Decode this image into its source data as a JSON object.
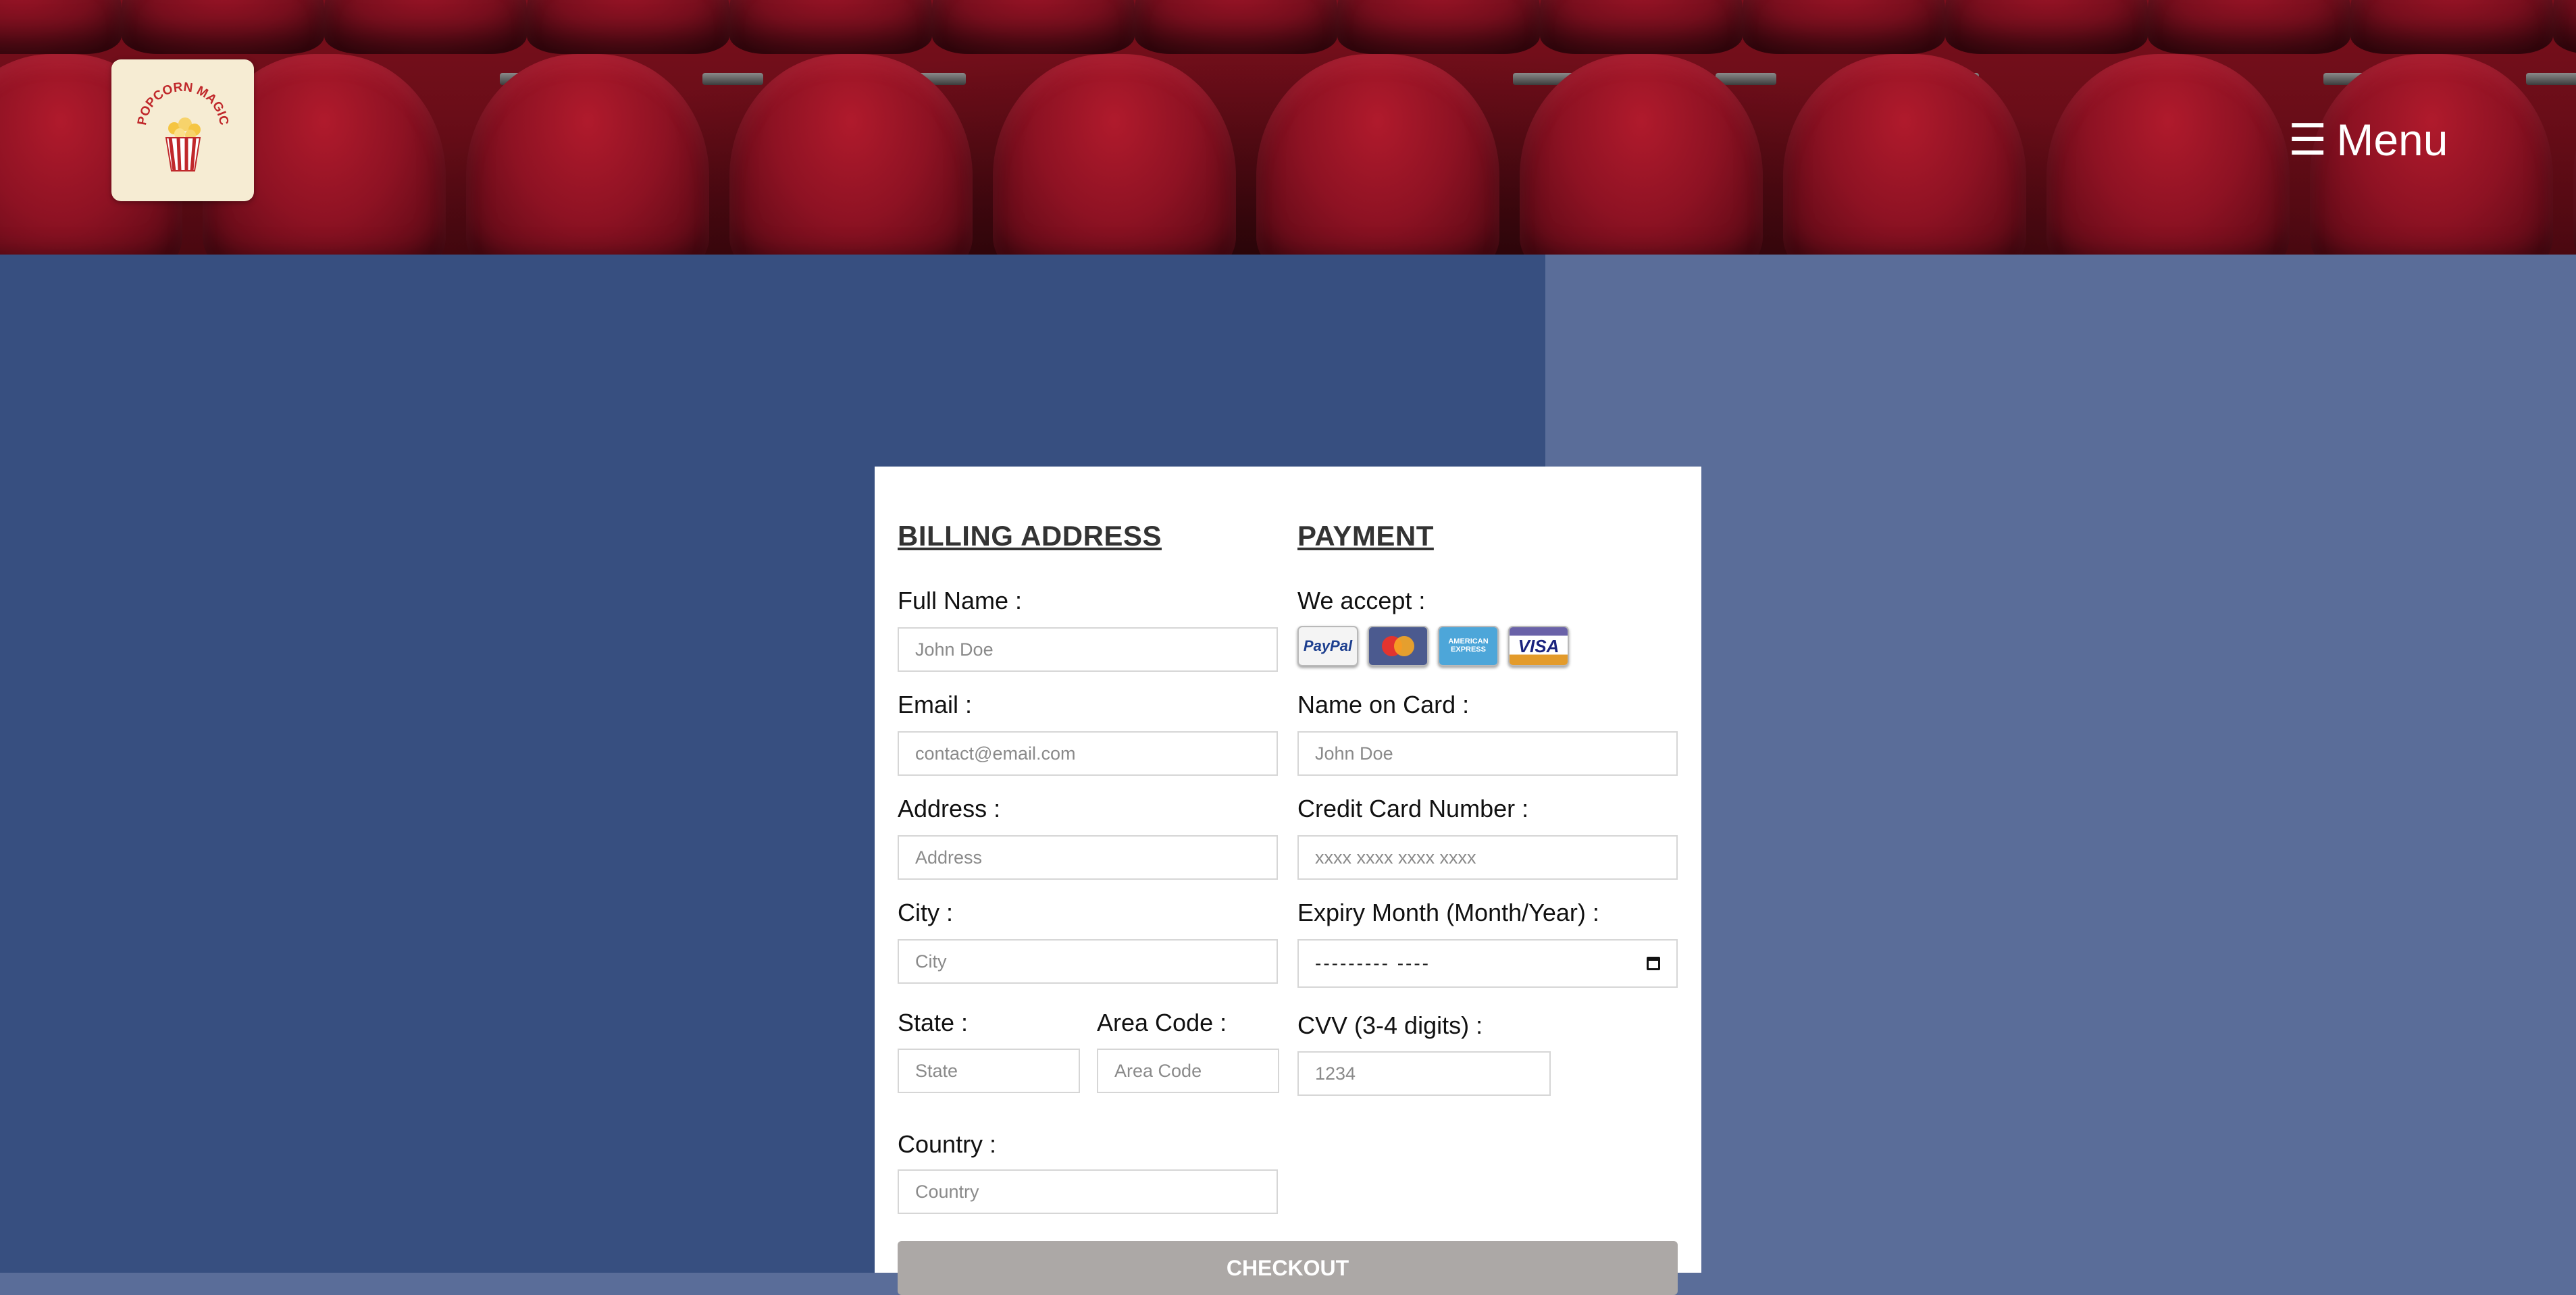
{
  "header": {
    "logo_name": "popcorn-logo",
    "logo_text": "POPCORN MAGIC",
    "menu_label": "Menu",
    "menu_icon": "hamburger-icon"
  },
  "billing": {
    "title": "BILLING ADDRESS",
    "full_name": {
      "label": "Full Name :",
      "placeholder": "John Doe"
    },
    "email": {
      "label": "Email :",
      "placeholder": "contact@email.com"
    },
    "address": {
      "label": "Address :",
      "placeholder": "Address"
    },
    "city": {
      "label": "City :",
      "placeholder": "City"
    },
    "state": {
      "label": "State :",
      "placeholder": "State"
    },
    "area_code": {
      "label": "Area Code :",
      "placeholder": "Area Code"
    },
    "country": {
      "label": "Country :",
      "placeholder": "Country"
    }
  },
  "payment": {
    "title": "PAYMENT",
    "we_accept_label": "We accept :",
    "cards": [
      {
        "name": "paypal-icon",
        "text": "PayPal"
      },
      {
        "name": "mastercard-icon",
        "text": "MasterCard"
      },
      {
        "name": "amex-icon",
        "text": "AMERICAN EXPRESS"
      },
      {
        "name": "visa-icon",
        "text": "VISA"
      }
    ],
    "name_on_card": {
      "label": "Name on Card :",
      "placeholder": "John Doe"
    },
    "card_number": {
      "label": "Credit Card Number :",
      "placeholder": "xxxx xxxx xxxx xxxx"
    },
    "expiry": {
      "label": "Expiry Month (Month/Year) :",
      "value": "---------  ----"
    },
    "cvv": {
      "label": "CVV (3-4 digits) :",
      "placeholder": "1234"
    }
  },
  "checkout_label": "CHECKOUT",
  "colors": {
    "panel_left": "#374f80",
    "panel_right": "#5a6d99",
    "checkout_button": "#aca8a6",
    "header_seats": "#8e1223"
  }
}
